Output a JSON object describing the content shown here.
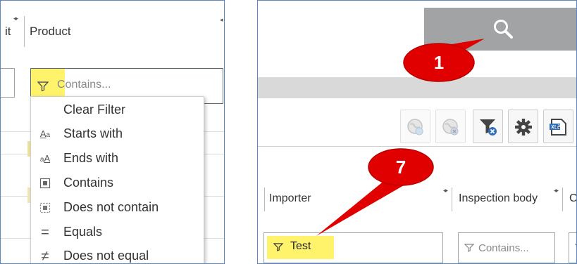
{
  "left_panel": {
    "column_prev_fragment": "it",
    "column_product": "Product",
    "filter_placeholder": "Contains...",
    "menu": [
      {
        "icon": "",
        "label": "Clear Filter"
      },
      {
        "icon": "starts-with-icon",
        "label": "Starts with"
      },
      {
        "icon": "ends-with-icon",
        "label": "Ends with"
      },
      {
        "icon": "contains-icon",
        "label": "Contains"
      },
      {
        "icon": "does-not-contain-icon",
        "label": "Does not contain"
      },
      {
        "icon": "equals-icon",
        "label": "Equals"
      },
      {
        "icon": "not-equal-icon",
        "label": "Does not equal"
      }
    ]
  },
  "right_panel": {
    "columns": [
      "Importer",
      "Inspection body",
      "C"
    ],
    "importer_filter_value": "Test",
    "inspection_filter_placeholder": "Contains...",
    "toolbar_icons": [
      "globe-refresh-icon",
      "globe-remove-icon",
      "clear-filter-icon",
      "settings-gear-icon",
      "export-xls-icon"
    ]
  },
  "callouts": [
    {
      "number": "1",
      "target": "search-button"
    },
    {
      "number": "7",
      "target": "importer-filter"
    }
  ],
  "colors": {
    "highlight": "#fff36b",
    "callout_red": "#e00000",
    "panel_border": "#5b87c4",
    "search_bar": "#a2a3a5"
  }
}
